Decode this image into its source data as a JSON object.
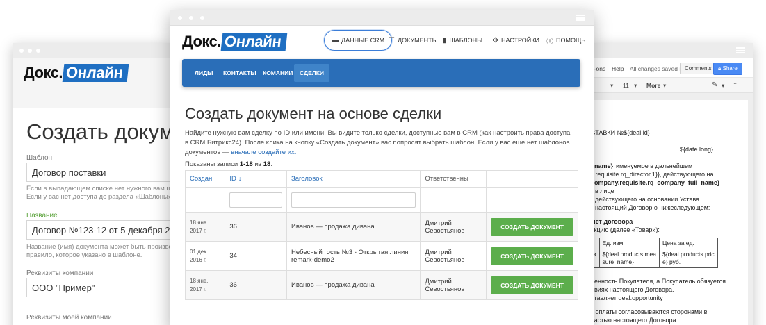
{
  "left_window": {
    "logo_part1": "Докс.",
    "logo_part2": "Онлайн",
    "heading": "Создать докум",
    "template_label": "Шаблон",
    "template_value": "Договор поставки",
    "template_help_1": "Если в выпадающем списке нет нужного вам шаб",
    "template_help_2": "Если у вас нет доступа до раздела «Шаблоны» об",
    "name_label": "Название",
    "name_value": "Договор №123-12 от 5 декабря 2016",
    "name_help_1": "Название (имя) документа может быть произвол",
    "name_help_2": "правило, которое указано в шаблоне.",
    "company_label": "Реквизиты компании",
    "company_value": "ООО \"Пример\"",
    "my_company_label": "Реквизиты моей компании"
  },
  "main_window": {
    "logo_part1": "Докс.",
    "logo_part2": "Онлайн",
    "nav": [
      {
        "label": "ДАННЫЕ CRM",
        "icon": "chat-icon"
      },
      {
        "label": "ДОКУМЕНТЫ",
        "icon": "list-icon"
      },
      {
        "label": "ШАБЛОНЫ",
        "icon": "file-icon"
      },
      {
        "label": "НАСТРОЙКИ",
        "icon": "gear-icon"
      },
      {
        "label": "ПОМОЩЬ",
        "icon": "help-icon"
      }
    ],
    "subnav": [
      "ЛИДЫ",
      "КОНТАКТЫ",
      "КОМАНИИ",
      "СДЕЛКИ"
    ],
    "title": "Создать документ на основе сделки",
    "intro_1": "Найдите нужную вам сделку по ID или имени. Вы видите только сделки, доступные вам в CRM (как настроить права доступа в CRM Битрикс24). После клика на кнопку «Создать документ» вас попросят выбрать шаблон. Если у вас еще нет шаблонов документов — ",
    "intro_link": "вначале создайте их.",
    "shown_prefix": "Показаны записи ",
    "shown_range": "1-18",
    "shown_mid": " из ",
    "shown_total": "18",
    "shown_suffix": ".",
    "columns": [
      "Создан",
      "ID",
      "Заголовок",
      "Ответственны"
    ],
    "sort_icon": "↓",
    "rows": [
      {
        "date": "18 янв. 2017 г.",
        "id": "36",
        "title": "Иванов — продажа дивана",
        "owner": "Дмитрий Севостьянов",
        "button": "СОЗДАТЬ ДОКУМЕНТ"
      },
      {
        "date": "01 дек. 2016 г.",
        "id": "34",
        "title": "Небесный гость №3 - Открытая линия remark-demo2",
        "owner": "Дмитрий Севостьянов",
        "button": "СОЗДАТЬ ДОКУМЕНТ"
      },
      {
        "date": "18 янв. 2017 г.",
        "id": "36",
        "title": "Иванов — продажа дивана",
        "owner": "Дмитрий Севостьянов",
        "button": "СОЗДАТЬ ДОКУМЕНТ"
      }
    ]
  },
  "right_window": {
    "menu_addons": "d-ons",
    "menu_help": "Help",
    "saved": "All changes saved i...",
    "comments_btn": "Comments",
    "share_btn": "Share",
    "font_size": "11",
    "more": "More",
    "doc_lines": [
      "СТАВКИ №${deal.id}",
      "${date.long}",
      "_name}",
      " именуемое в дальнейшем",
      "y.requisite.rq_director,1}}, действующего на",
      "company.requisite.rq_company_full_name}",
      "в лице",
      "действующего на основании Устава",
      "настоящий Договор о нижеследующем:",
      "мет договора",
      "укцию (далее «Товар»):",
      "ненность Покупателя, а Покупатель обязуется",
      "овиях настоящего Договора.",
      "ставляет deal.opportunity",
      "к оплаты согласовываются сторонами в",
      "частью настоящего Договора."
    ],
    "table_head": [
      "Ед. изм.",
      "Цена за ед."
    ],
    "table_row": [
      "${deal.products.mea sure_name}",
      "${deal.products.pric e} руб."
    ],
    "table_first_col": "в"
  },
  "colors": {
    "brand": "#1f6fc2",
    "nav_bar": "#2a6eb8",
    "button": "#5cae4c",
    "label_green": "#5aa23a"
  }
}
